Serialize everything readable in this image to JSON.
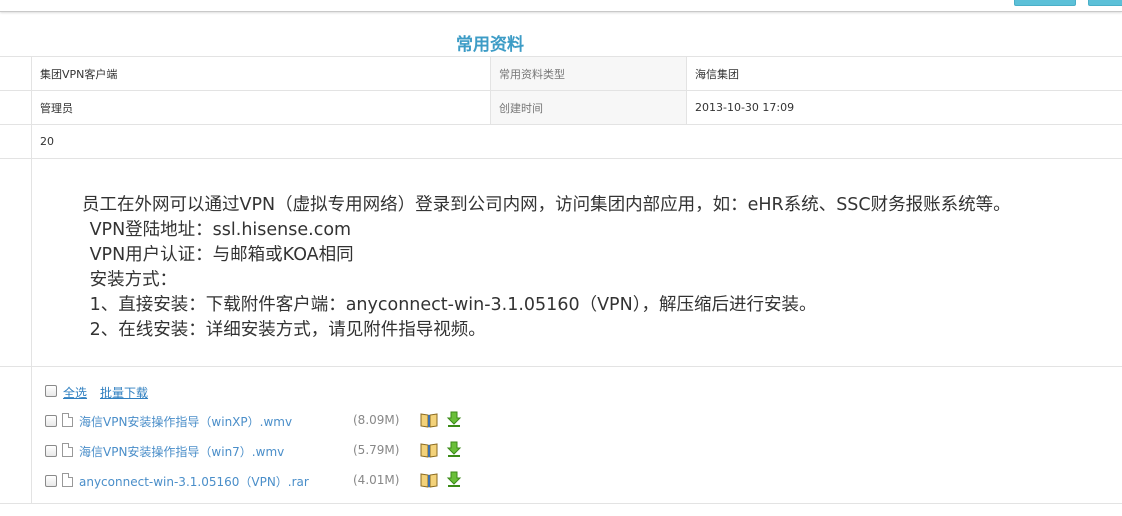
{
  "page_title": "常用资料",
  "row1": {
    "name_value": "集团VPN客户端",
    "type_label": "常用资料类型",
    "type_value": "海信集团"
  },
  "row2": {
    "creator_value": "管理员",
    "time_label": "创建时间",
    "time_value": "2013-10-30 17:09"
  },
  "row3": {
    "count_value": "20"
  },
  "content": {
    "lines": [
      "员工在外网可以通过VPN（虚拟专用网络）登录到公司内网，访问集团内部应用，如：eHR系统、SSC财务报账系统等。",
      " VPN登陆地址：ssl.hisense.com",
      " VPN用户认证：与邮箱或KOA相同",
      " 安装方式：",
      " 1、直接安装：下载附件客户端：anyconnect-win-3.1.05160（VPN），解压缩后进行安装。",
      " 2、在线安装：详细安装方式，请见附件指导视频。"
    ]
  },
  "attachments": {
    "select_all": "全选",
    "batch_download": "批量下载",
    "files": [
      {
        "name": "海信VPN安装操作指导（winXP）.wmv",
        "size": "(8.09M)"
      },
      {
        "name": "海信VPN安装操作指导（win7）.wmv",
        "size": "(5.79M)"
      },
      {
        "name": "anyconnect-win-3.1.05160（VPN）.rar",
        "size": "(4.01M)"
      }
    ]
  }
}
